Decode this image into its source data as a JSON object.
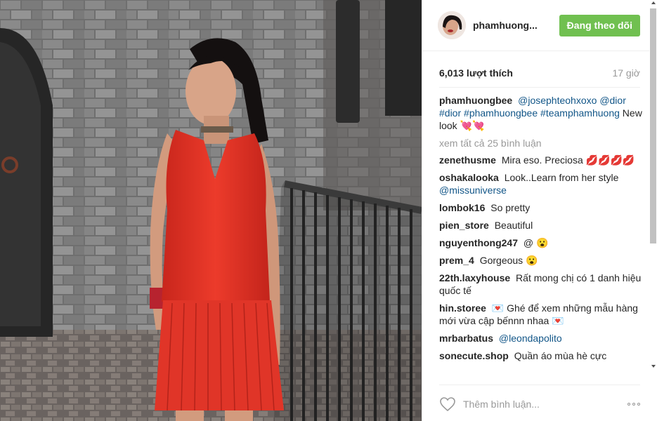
{
  "post": {
    "username": "phamhuong...",
    "follow_label": "Đang theo dõi",
    "likes": "6,013 lượt thích",
    "time": "17 giờ"
  },
  "caption": {
    "user": "phamhuongbee",
    "parts": [
      "@josephteohxoxo",
      "@dior",
      "#dior",
      "#phamhuongbee",
      "#teamphamhuong"
    ],
    "text": "New look 💘💘"
  },
  "view_all": "xem tất cả 25 bình luận",
  "comments": [
    {
      "user": "zenethusme",
      "text": "Mira eso. Preciosa 💋💋💋💋"
    },
    {
      "user": "oshakalooka",
      "text": "Look..Learn from her style",
      "tag": "@missuniverse"
    },
    {
      "user": "lombok16",
      "text": "So pretty"
    },
    {
      "user": "pien_store",
      "text": "Beautiful"
    },
    {
      "user": "nguyenthong247",
      "text": "@ 😮"
    },
    {
      "user": "prem_4",
      "text": "Gorgeous 😮"
    },
    {
      "user": "22th.laxyhouse",
      "text": "Rất mong chị có 1 danh hiệu quốc tế"
    },
    {
      "user": "hin.storee",
      "text": "💌 Ghé để xem những mẫu hàng mới vừa cập bếnnn nhaa 💌"
    },
    {
      "user": "mrbarbatus",
      "text": "",
      "tag": "@leondapolito"
    },
    {
      "user": "sonecute.shop",
      "text": "Quần áo mùa hè cực"
    }
  ],
  "footer": {
    "placeholder": "Thêm bình luận..."
  },
  "icons": {
    "like": "heart-icon",
    "more": "more-options-icon"
  },
  "colors": {
    "follow": "#70c050",
    "link": "#125688",
    "muted": "#999999"
  }
}
